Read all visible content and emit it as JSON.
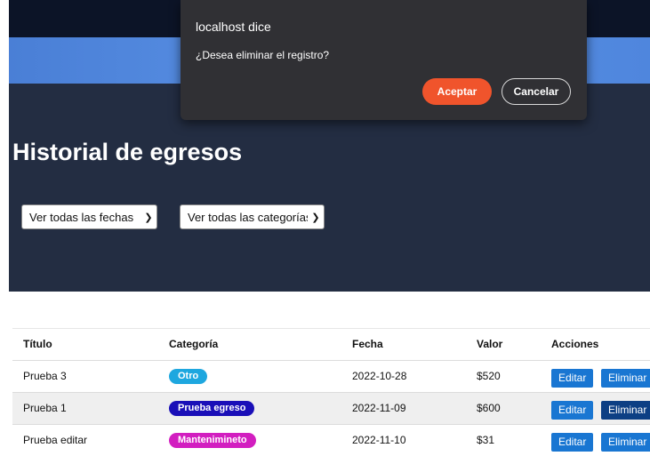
{
  "page": {
    "title": "Historial de egresos"
  },
  "filters": {
    "dates_selected": "Ver todas las fechas",
    "categories_selected": "Ver todas las categorías"
  },
  "table": {
    "headers": [
      "Título",
      "Categoría",
      "Fecha",
      "Valor",
      "Acciones"
    ],
    "rows": [
      {
        "title": "Prueba 3",
        "category": "Otro",
        "category_color": "#1ea7df",
        "date": "2022-10-28",
        "value": "$520"
      },
      {
        "title": "Prueba 1",
        "category": "Prueba egreso",
        "category_color": "#1a0fb8",
        "date": "2022-11-09",
        "value": "$600"
      },
      {
        "title": "Prueba editar",
        "category": "Mantenimineto",
        "category_color": "#d21ec0",
        "date": "2022-11-10",
        "value": "$31"
      }
    ],
    "edit_label": "Editar",
    "delete_label": "Eliminar"
  },
  "dialog": {
    "title": "localhost dice",
    "message": "¿Desea eliminar el registro?",
    "accept_label": "Aceptar",
    "cancel_label": "Cancelar",
    "accent_color": "#f0542c"
  },
  "icons": {
    "dropdown": "chevron-down-icon"
  }
}
